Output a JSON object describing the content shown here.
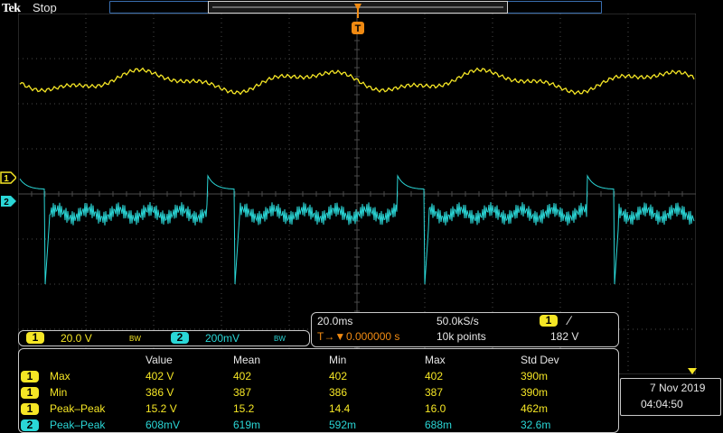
{
  "header": {
    "brand": "Tek",
    "status": "Stop"
  },
  "channels": [
    {
      "id": "1",
      "scale": "20.0 V",
      "bw_label": "BW",
      "color": "#f5e625"
    },
    {
      "id": "2",
      "scale": "200mV",
      "bw_label": "BW",
      "color": "#2ad6d6"
    }
  ],
  "trigger": {
    "marker": "T",
    "source": "1",
    "slope_glyph": "∕",
    "level": "182 V",
    "position": "0.000000 s",
    "position_prefix": "T→▼"
  },
  "acquisition": {
    "timebase": "20.0ms",
    "sample_rate": "50.0kS/s",
    "record_length": "10k points"
  },
  "measurements": {
    "headers": [
      "Value",
      "Mean",
      "Min",
      "Max",
      "Std Dev"
    ],
    "rows": [
      {
        "channel": "1",
        "name": "Max",
        "value": "402 V",
        "mean": "402",
        "min": "402",
        "max": "402",
        "std": "390m"
      },
      {
        "channel": "1",
        "name": "Min",
        "value": "386 V",
        "mean": "387",
        "min": "386",
        "max": "387",
        "std": "390m"
      },
      {
        "channel": "1",
        "name": "Peak–Peak",
        "value": "15.2 V",
        "mean": "15.2",
        "min": "14.4",
        "max": "16.0",
        "std": "462m"
      },
      {
        "channel": "2",
        "name": "Peak–Peak",
        "value": "608mV",
        "mean": "619m",
        "min": "592m",
        "max": "688m",
        "std": "32.6m"
      }
    ]
  },
  "datetime": {
    "date": "7 Nov 2019",
    "time": "04:04:50"
  },
  "colors": {
    "ch1": "#f5e625",
    "ch2": "#2ad6d6",
    "trigger": "#f08a12",
    "grid": "#4a4a4a"
  }
}
